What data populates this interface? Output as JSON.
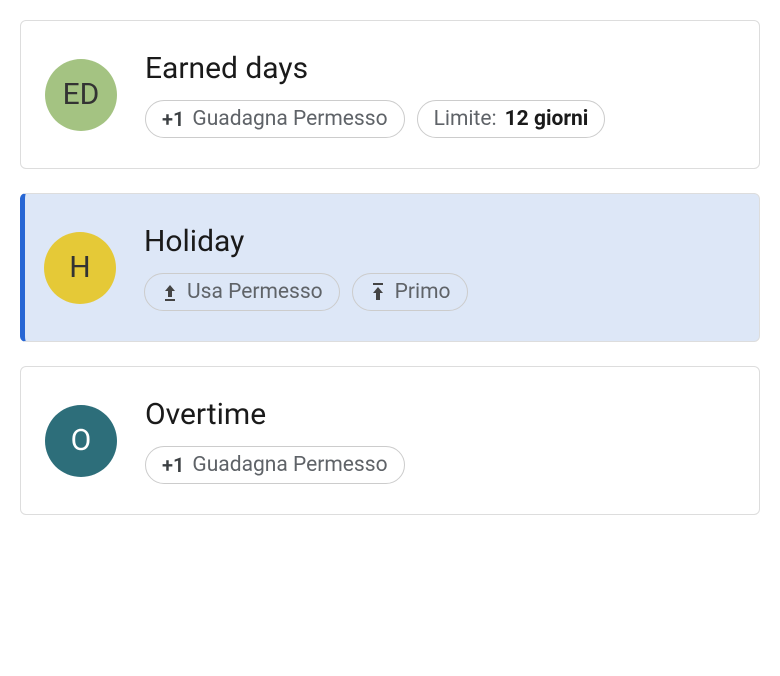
{
  "cards": [
    {
      "selected": false,
      "avatarBg": "#a4c382",
      "avatarText": "ED",
      "title": "Earned days",
      "chips": [
        {
          "type": "plus",
          "iconText": "+1",
          "label": "Guadagna Permesso"
        },
        {
          "type": "limit",
          "prefixLabel": "Limite:",
          "value": "12 giorni"
        }
      ]
    },
    {
      "selected": true,
      "avatarBg": "#e5c937",
      "avatarText": "H",
      "title": "Holiday",
      "chips": [
        {
          "type": "arrow-bar",
          "label": "Usa Permesso"
        },
        {
          "type": "arrow-top",
          "label": "Primo"
        }
      ]
    },
    {
      "selected": false,
      "avatarBg": "#2d6e7a",
      "avatarText": "O",
      "avatarColor": "#fff",
      "title": "Overtime",
      "chips": [
        {
          "type": "plus",
          "iconText": "+1",
          "label": "Guadagna Permesso"
        }
      ]
    }
  ]
}
